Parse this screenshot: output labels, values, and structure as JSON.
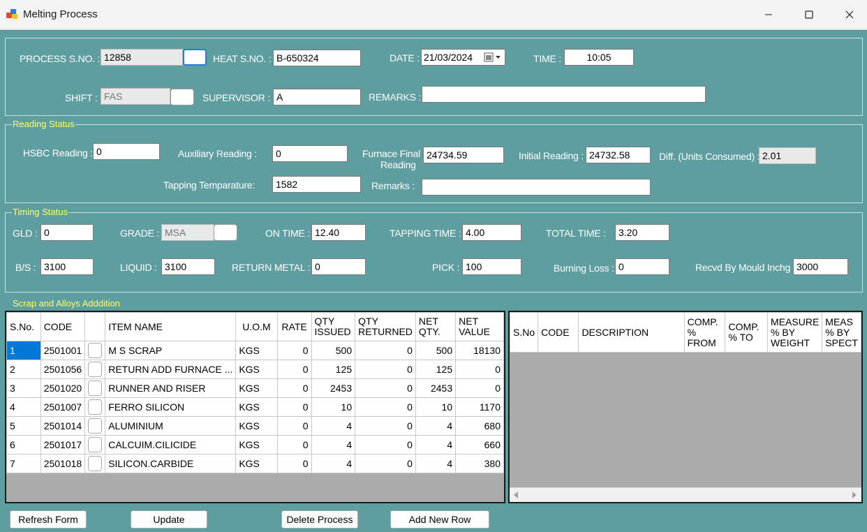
{
  "window": {
    "title": "Melting Process"
  },
  "header": {
    "process_sno_label": "PROCESS S.NO. :",
    "process_sno": "12858",
    "heat_sno_label": "HEAT S.NO. :",
    "heat_sno": "B-650324",
    "date_label": "DATE :",
    "date": "21/03/2024",
    "time_label": "TIME :",
    "time": "10:05",
    "shift_label": "SHIFT :",
    "shift": "FAS",
    "supervisor_label": "SUPERVISOR :",
    "supervisor": "A",
    "remarks_label": "REMARKS :",
    "remarks": ""
  },
  "reading": {
    "title": "Reading Status",
    "hsbc_label": "HSBC Reading :",
    "hsbc": "0",
    "aux_label": "Auxiliary Reading :",
    "aux": "0",
    "furnace_label_1": "Furnace Final",
    "furnace_label_2": "Reading",
    "furnace": "24734.59",
    "initial_label": "Initial Reading :",
    "initial": "24732.58",
    "diff_label": "Diff. (Units Consumed) :",
    "diff": "2.01",
    "tapping_temp_label": "Tapping Temparature:",
    "tapping_temp": "1582",
    "remarks_label": "Remarks :",
    "remarks": ""
  },
  "timing": {
    "title": "Timing Status",
    "gld_label": "GLD :",
    "gld": "0",
    "grade_label": "GRADE :",
    "grade": "MSA",
    "on_time_label": "ON TIME :",
    "on_time": "12.40",
    "tapping_time_label": "TAPPING TIME :",
    "tapping_time": "4.00",
    "total_time_label": "TOTAL TIME :",
    "total_time": "3.20",
    "bs_label": "B/S :",
    "bs": "3100",
    "liquid_label": "LIQUID :",
    "liquid": "3100",
    "return_metal_label": "RETURN METAL :",
    "return_metal": "0",
    "pick_label": "PICK :",
    "pick": "100",
    "burning_loss_label": "Burning Loss :",
    "burning_loss": "0",
    "recvd_label": "Recvd By Mould Inchg",
    "recvd": "3000"
  },
  "scrap": {
    "title": "Scrap and Alloys Adddition",
    "columns": [
      "S.No.",
      "CODE",
      "",
      "ITEM NAME",
      "U.O.M",
      "RATE",
      "QTY ISSUED",
      "QTY RETURNED",
      "NET QTY.",
      "NET VALUE"
    ],
    "rows": [
      [
        "1",
        "2501001",
        "",
        "M S SCRAP",
        "KGS",
        "0",
        "500",
        "0",
        "500",
        "18130"
      ],
      [
        "2",
        "2501056",
        "",
        "RETURN ADD FURNACE ...",
        "KGS",
        "0",
        "125",
        "0",
        "125",
        "0"
      ],
      [
        "3",
        "2501020",
        "",
        "RUNNER AND RISER",
        "KGS",
        "0",
        "2453",
        "0",
        "2453",
        "0"
      ],
      [
        "4",
        "2501007",
        "",
        "FERRO  SILICON",
        "KGS",
        "0",
        "10",
        "0",
        "10",
        "1170"
      ],
      [
        "5",
        "2501014",
        "",
        "ALUMINIUM",
        "KGS",
        "0",
        "4",
        "0",
        "4",
        "680"
      ],
      [
        "6",
        "2501017",
        "",
        "CALCUIM.CILICIDE",
        "KGS",
        "0",
        "4",
        "0",
        "4",
        "660"
      ],
      [
        "7",
        "2501018",
        "",
        "SILICON.CARBIDE",
        "KGS",
        "0",
        "4",
        "0",
        "4",
        "380"
      ]
    ]
  },
  "composition": {
    "columns": [
      "S.No",
      "CODE",
      "DESCRIPTION",
      "COMP. % FROM",
      "COMP. % TO",
      "MEASURE % BY WEIGHT",
      "MEAS % BY SPECT"
    ]
  },
  "buttons": {
    "refresh": "Refresh Form",
    "update": "Update",
    "delete": "Delete Process",
    "add_row": "Add New Row"
  }
}
